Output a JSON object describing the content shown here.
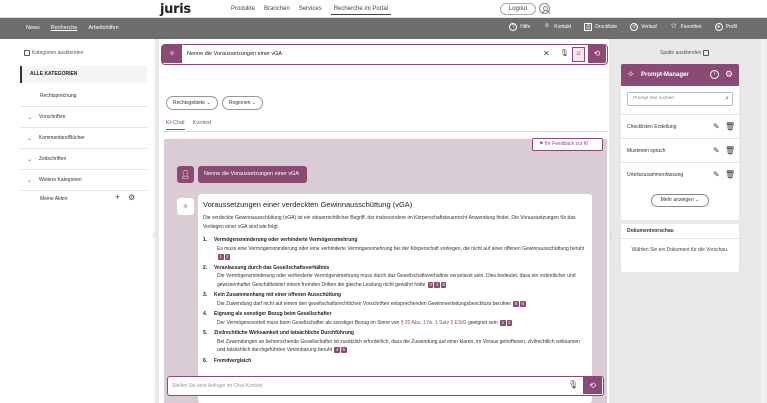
{
  "topbar": {
    "logo": "juris",
    "nav": [
      "Produkte",
      "Branchen",
      "Services",
      "Recherche im Portal"
    ],
    "logout": "Logout"
  },
  "navbar": {
    "left": [
      "News",
      "Recherche",
      "Arbeitshilfen"
    ],
    "right": [
      {
        "label": "Hilfe",
        "icon": "help-icon"
      },
      {
        "label": "Kontakt",
        "icon": "phone-icon"
      },
      {
        "label": "Druckliste",
        "icon": "print-icon"
      },
      {
        "label": "Verlauf",
        "icon": "history-icon"
      },
      {
        "label": "Favoriten",
        "icon": "star-icon"
      },
      {
        "label": "Profil",
        "icon": "user-icon"
      }
    ]
  },
  "left_panel": {
    "hide_label": "Kategorien ausblenden",
    "all_label": "ALLE KATEGORIEN",
    "items": [
      "Rechtsprechung",
      "Vorschriften",
      "Kommentare/Bücher",
      "Zeitschriften",
      "Weitere Kategorien"
    ],
    "meine_akten": "Meine Akten"
  },
  "search": {
    "value": "Nenne die Voraussetzungen einer vGA"
  },
  "filters": [
    "Rechtsgebiete",
    "Regionen"
  ],
  "tabs": [
    "KI-Chat",
    "Kontext"
  ],
  "chat": {
    "feedback_label": "Ihr Feedback zur KI",
    "user_message": "Nenne die Voraussetzungen einer vGA",
    "answer_title": "Voraussetzungen einer verdeckten Gewinnausschüttung (vGA)",
    "answer_intro": "Die verdeckte Gewinnausschüttung (vGA) ist ein steuerrechtlicher Begriff, der insbesondere im Körperschaftsteuerrecht Anwendung findet. Die Voraussetzungen für das Vorliegen einer vGA sind wie folgt:",
    "points": [
      {
        "num": "1.",
        "title": "Vermögensminderung oder verhinderte Vermögensmehrung",
        "desc": "Es muss eine Vermögensminderung oder eine verhinderte Vermögensmehrung bei der Körperschaft vorliegen, die nicht auf einer offenen Gewinnausschüttung beruht",
        "refs": [
          "1",
          "2"
        ]
      },
      {
        "num": "2.",
        "title": "Veranlassung durch das Gesellschaftsverhältnis",
        "desc": "Die Vermögensminderung oder verhinderte Vermögensmehrung muss durch das Gesellschaftsverhältnis veranlasst sein. Dies bedeutet, dass ein ordentlicher und gewissenhafter Geschäftsleiter einem fremden Dritten die gleiche Leistung nicht gewährt hätte",
        "refs": [
          "3",
          "4",
          "5"
        ]
      },
      {
        "num": "3.",
        "title": "Kein Zusammenhang mit einer offenen Ausschüttung",
        "desc": "Die Zuwendung darf nicht auf einem den gesellschaftsrechtlichen Vorschriften entsprechenden Gewinnverteilungsbeschluss beruhen",
        "refs": [
          "5",
          "6"
        ]
      },
      {
        "num": "4.",
        "title": "Eignung als sonstiger Bezug beim Gesellschafter",
        "desc": "Der Vermögensvorteil muss beim Gesellschafter als sonstiger Bezug im Sinne von",
        "link": "§ 20 Abs. 1 Nr. 1 Satz 2 EStG",
        "desc2": "geeignet sein",
        "refs": [
          "1",
          "2"
        ]
      },
      {
        "num": "5.",
        "title": "Zivilrechtliche Wirksamkeit und tatsächliche Durchführung",
        "desc": "Bei Zuwendungen an beherrschende Gesellschafter ist zusätzlich erforderlich, dass die Zuwendung auf einer klaren, im Voraus getroffenen, zivilrechtlich wirksamen und tatsächlich durchgeführten Vereinbarung beruht",
        "refs": [
          "4",
          "5"
        ]
      },
      {
        "num": "6.",
        "title": "Fremdvergleich",
        "desc": "",
        "refs": []
      }
    ],
    "input_placeholder": "Stellen Sie eine Anfrage im Chat-Kontext"
  },
  "right_panel": {
    "hide_label": "Spalte ausblenden",
    "prompt_manager": {
      "title": "Prompt-Manager",
      "search_placeholder": "Prompt titel suchen",
      "items": [
        "Checklisten Erstellung",
        "Musterein spruch",
        "Urteilszusammenfassung"
      ],
      "more_label": "Mehr anzeigen"
    },
    "doc_preview": {
      "title": "Dokumentvorschau",
      "body": "Wählen Sie ein Dokument für die Vorschau."
    }
  },
  "colors": {
    "accent": "#8a4a73",
    "navbar": "#6e6e6e",
    "chat_bg": "#d9ccd4"
  }
}
